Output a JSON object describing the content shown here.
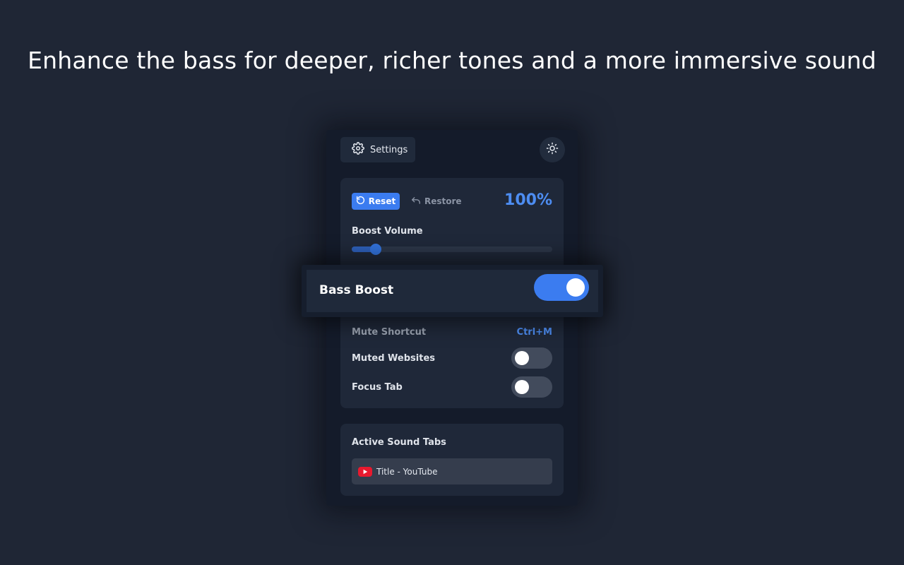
{
  "headline": "Enhance the bass for deeper, richer tones and a more immersive sound",
  "header": {
    "settings_label": "Settings",
    "settings_icon": "gear-icon",
    "theme_icon": "sun-icon"
  },
  "volume_card": {
    "reset_label": "Reset",
    "restore_label": "Restore",
    "volume_percent": "100%",
    "boost_volume_label": "Boost Volume",
    "boost_slider_value": 0.12,
    "mute_shortcut_label": "Mute Shortcut",
    "mute_shortcut_value": "Ctrl+M",
    "muted_websites_label": "Muted Websites",
    "muted_websites_on": false,
    "focus_tab_label": "Focus Tab",
    "focus_tab_on": false
  },
  "bass_boost": {
    "label": "Bass Boost",
    "enabled": true
  },
  "active_tabs": {
    "title": "Active Sound Tabs",
    "items": [
      {
        "title": "Title - YouTube",
        "icon": "youtube-icon"
      }
    ]
  },
  "colors": {
    "accent": "#3b7cf0",
    "background": "#1f2635",
    "youtube_red": "#e8192e"
  }
}
